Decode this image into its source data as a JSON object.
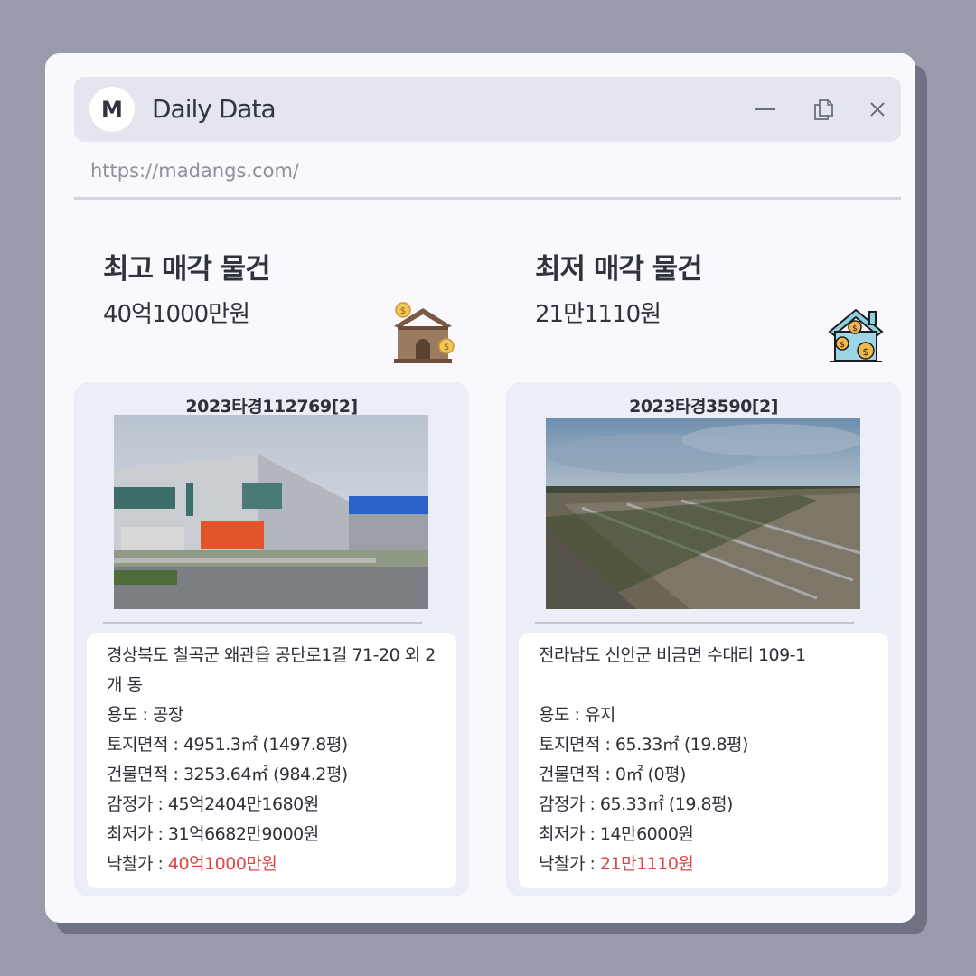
{
  "app": {
    "logo_letter": "M",
    "title": "Daily Data",
    "url": "https://madangs.com/"
  },
  "window_controls": {
    "icons": [
      "minimize-icon",
      "restore-icon",
      "close-icon"
    ]
  },
  "highest": {
    "heading": "최고 매각 물건",
    "amount": "40억1000만원",
    "icon": "house-money-icon",
    "case_no": "2023타경112769[2]",
    "address": "경상북도 칠곡군 왜관읍 공단로1길 71-20 외 2개 동",
    "use": "용도 : 공장",
    "land_area": "토지면적 : 4951.3㎡ (1497.8평)",
    "building_area": "건물면적 : 3253.64㎡ (984.2평)",
    "appraisal": "감정가 : 45억2404만1680원",
    "minimum": "최저가 : 31억6682만9000원",
    "winning_label": "낙찰가 : ",
    "winning_value": "40억1000만원"
  },
  "lowest": {
    "heading": "최저 매각 물건",
    "amount": "21만1110원",
    "icon": "house-coins-icon",
    "case_no": "2023타경3590[2]",
    "address": "전라남도 신안군 비금면 수대리 109-1",
    "use": "용도 : 유지",
    "land_area": "토지면적 : 65.33㎡ (19.8평)",
    "building_area": "건물면적 : 0㎡ (0평)",
    "appraisal": "감정가 : 65.33㎡ (19.8평)",
    "minimum": "최저가 : 14만6000원",
    "winning_label": "낙찰가 : ",
    "winning_value": "21만1110원"
  },
  "colors": {
    "highlight_price": "#e04545",
    "background": "#9a9cae",
    "window": "#f8f8fd",
    "card": "#eceef7"
  }
}
